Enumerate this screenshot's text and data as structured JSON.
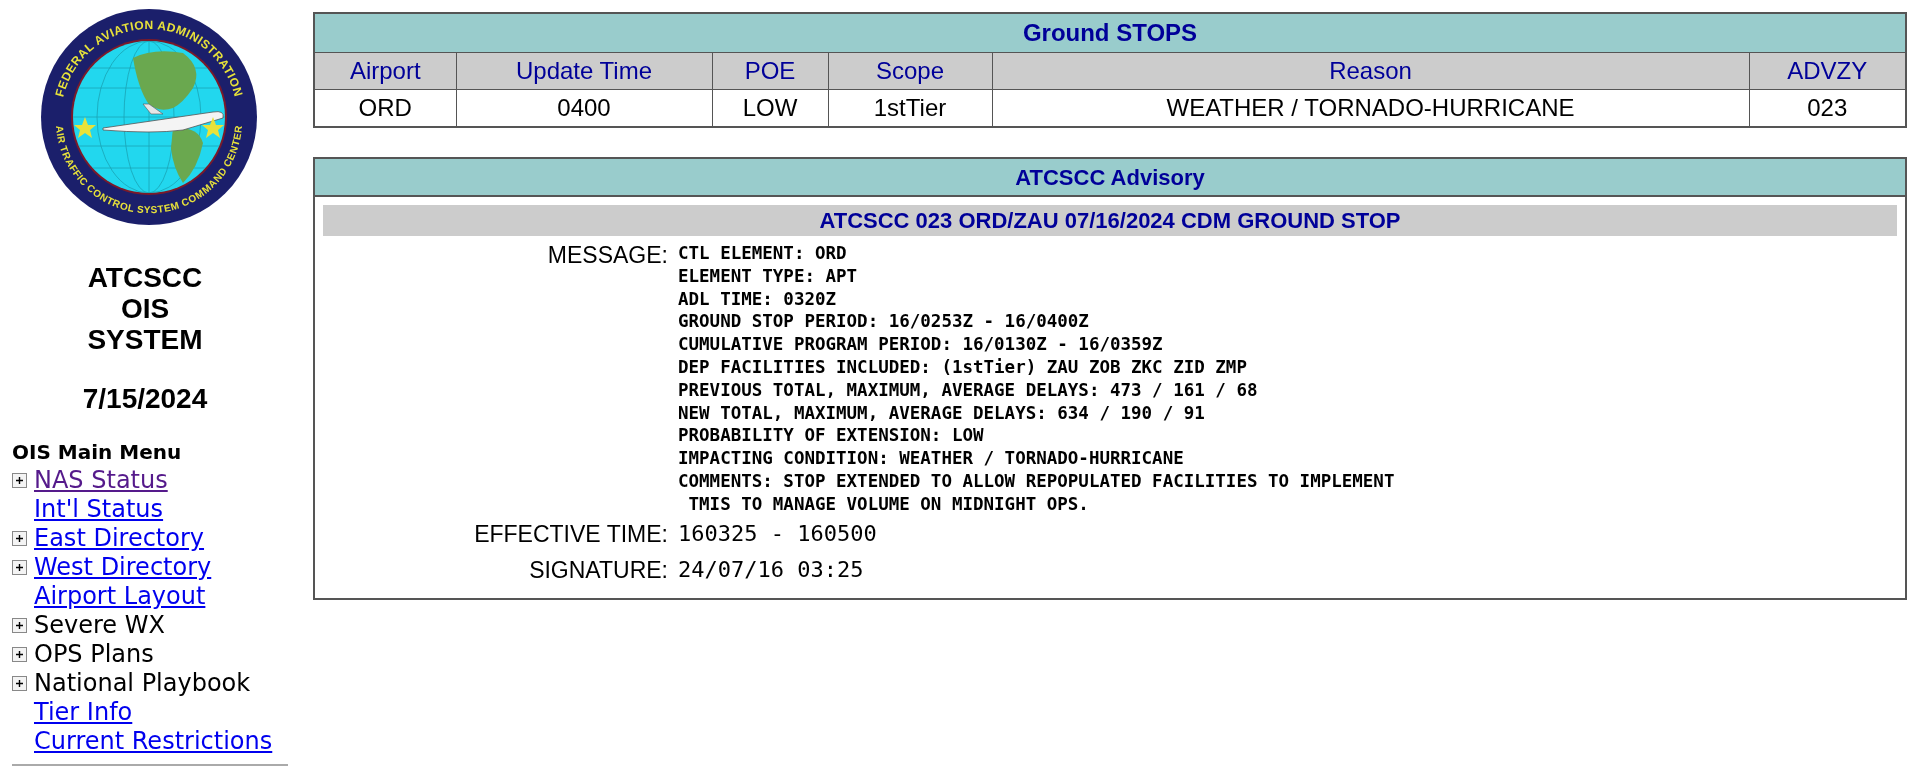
{
  "sidebar": {
    "logo": {
      "top_text": "FEDERAL AVIATION ADMINISTRATION",
      "bottom_text": "AIR TRAFFIC CONTROL SYSTEM COMMAND CENTER"
    },
    "system_title": [
      "ATCSCC",
      "OIS",
      "SYSTEM"
    ],
    "date": "7/15/2024",
    "menu_title": "OIS Main Menu",
    "menu": [
      {
        "label": "NAS Status",
        "kind": "link",
        "expandable": true,
        "visited": true
      },
      {
        "label": "Int'l Status",
        "kind": "link",
        "expandable": false,
        "visited": false
      },
      {
        "label": "East Directory",
        "kind": "link",
        "expandable": true,
        "visited": false
      },
      {
        "label": "West Directory",
        "kind": "link",
        "expandable": true,
        "visited": false
      },
      {
        "label": "Airport Layout",
        "kind": "link",
        "expandable": false,
        "visited": false
      },
      {
        "label": "Severe WX",
        "kind": "text",
        "expandable": true
      },
      {
        "label": "OPS Plans",
        "kind": "text",
        "expandable": true
      },
      {
        "label": "National Playbook",
        "kind": "text",
        "expandable": true
      },
      {
        "label": "Tier Info",
        "kind": "link",
        "expandable": false,
        "visited": false
      },
      {
        "label": "Current Restrictions",
        "kind": "link",
        "expandable": false,
        "visited": false
      }
    ]
  },
  "ground_stops": {
    "title": "Ground STOPS",
    "columns": [
      "Airport",
      "Update Time",
      "POE",
      "Scope",
      "Reason",
      "ADVZY"
    ],
    "rows": [
      [
        "ORD",
        "0400",
        "LOW",
        "1stTier",
        "WEATHER / TORNADO-HURRICANE",
        "023"
      ]
    ]
  },
  "advisory": {
    "title": "ATCSCC Advisory",
    "heading": "ATCSCC 023 ORD/ZAU 07/16/2024 CDM GROUND STOP",
    "fields": [
      {
        "label": "MESSAGE:",
        "kind": "multiline",
        "lines": [
          "CTL ELEMENT: ORD",
          "ELEMENT TYPE: APT",
          "ADL TIME: 0320Z",
          "GROUND STOP PERIOD: 16/0253Z - 16/0400Z",
          "CUMULATIVE PROGRAM PERIOD: 16/0130Z - 16/0359Z",
          "DEP FACILITIES INCLUDED: (1stTier) ZAU ZOB ZKC ZID ZMP",
          "PREVIOUS TOTAL, MAXIMUM, AVERAGE DELAYS: 473 / 161 / 68",
          "NEW TOTAL, MAXIMUM, AVERAGE DELAYS: 634 / 190 / 91",
          "PROBABILITY OF EXTENSION: LOW",
          "IMPACTING CONDITION: WEATHER / TORNADO-HURRICANE",
          "COMMENTS: STOP EXTENDED TO ALLOW REPOPULATED FACILITIES TO IMPLEMENT",
          " TMIS TO MANAGE VOLUME ON MIDNIGHT OPS."
        ]
      },
      {
        "label": "EFFECTIVE TIME:",
        "kind": "single",
        "value": "160325 - 160500"
      },
      {
        "label": "SIGNATURE:",
        "kind": "single",
        "value": "24/07/16 03:25"
      }
    ]
  }
}
